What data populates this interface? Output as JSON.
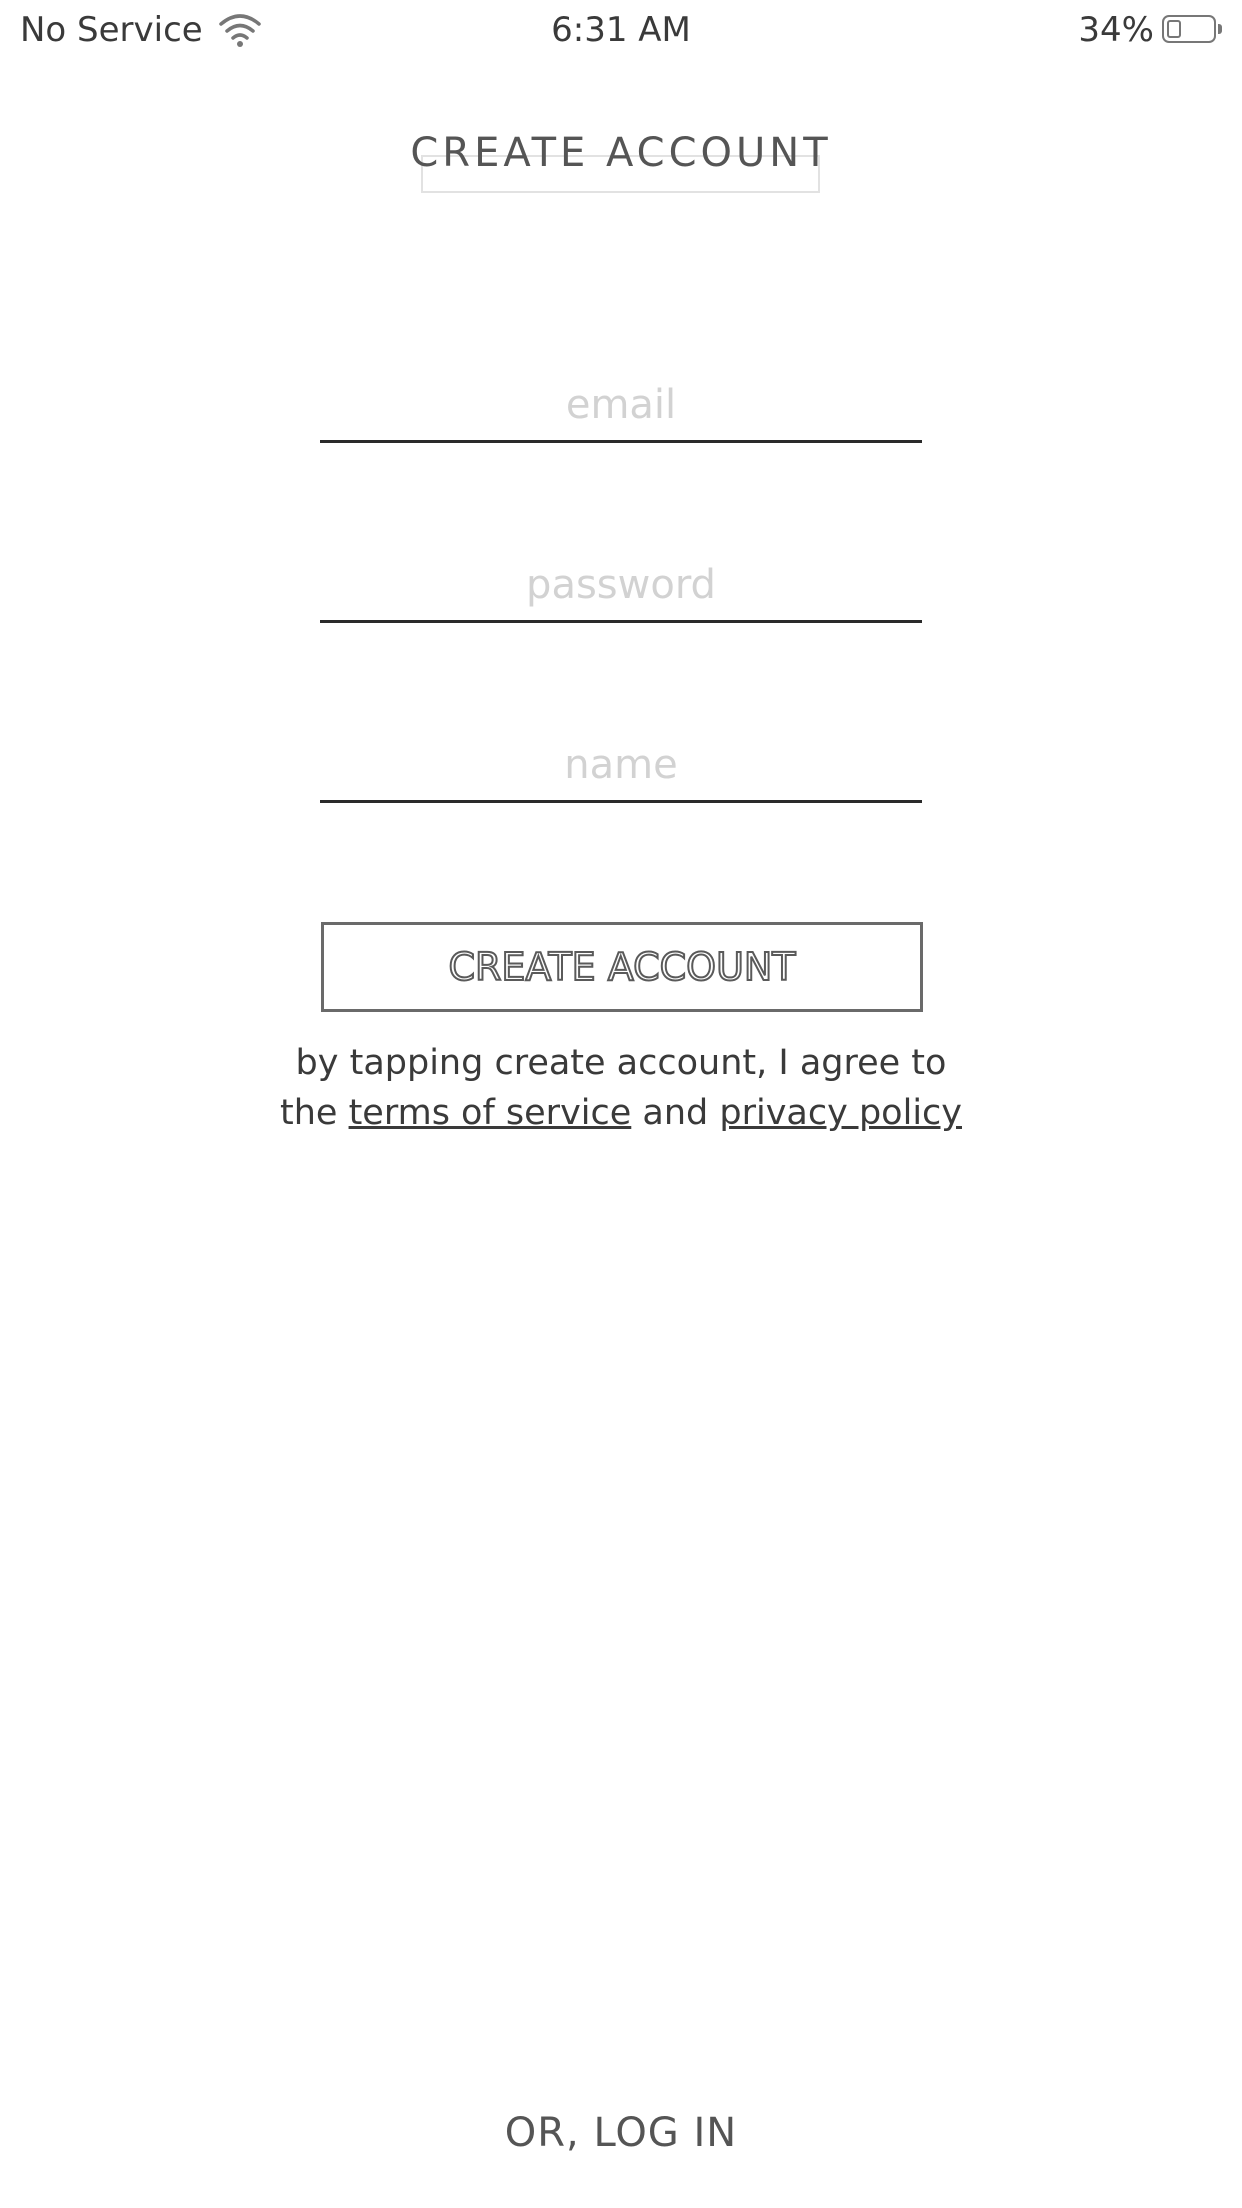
{
  "status_bar": {
    "carrier": "No Service",
    "time": "6:31 AM",
    "battery_percent": "34%",
    "battery_level": 0.34,
    "wifi_icon": "wifi-icon",
    "battery_icon": "battery-icon"
  },
  "header": {
    "title": "CREATE ACCOUNT"
  },
  "form": {
    "email_placeholder": "email",
    "email_value": "",
    "password_placeholder": "password",
    "password_value": "",
    "name_placeholder": "name",
    "name_value": "",
    "submit_label": "CREATE ACCOUNT"
  },
  "agreement": {
    "line1": "by tapping create account, I agree to",
    "prefix": "the ",
    "terms_link": "terms of service",
    "middle": " and ",
    "privacy_link": "privacy policy"
  },
  "footer": {
    "login_label": "OR, LOG IN"
  },
  "colors": {
    "text": "#3a3a3a",
    "placeholder": "#d2d2d2",
    "underline": "#2a2a2a",
    "button_border": "#6a6a6a",
    "background": "#ffffff"
  }
}
